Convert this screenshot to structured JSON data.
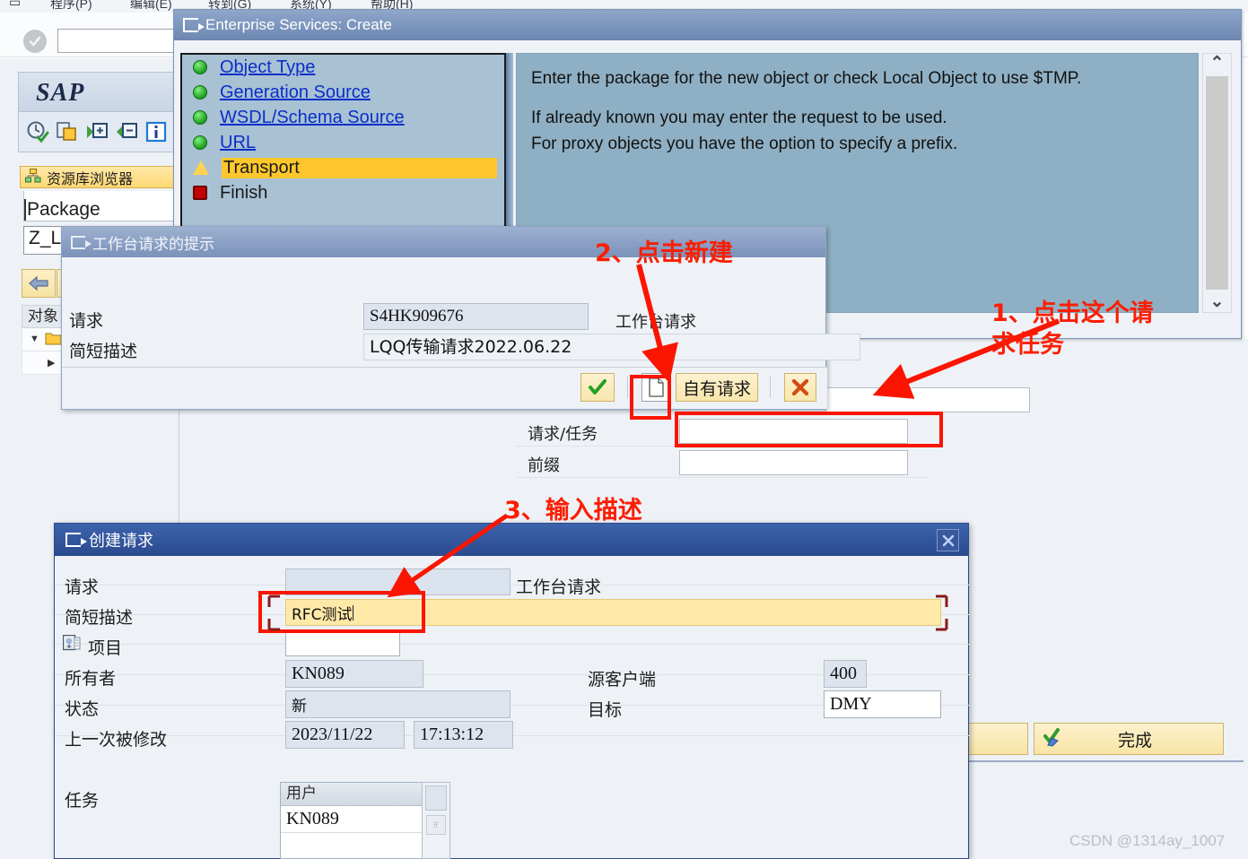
{
  "menubar": {
    "items": [
      "程序(P)",
      "编辑(E)",
      "转到(G)",
      "系统(Y)",
      "帮助(H)"
    ]
  },
  "command_field": {
    "value": "",
    "placeholder": ""
  },
  "sidebar": {
    "logo": "SAP",
    "repository_browser": "资源库浏览器",
    "package_label": "Package",
    "package_value": "Z_L",
    "object_column_header": "对象"
  },
  "es_window": {
    "title": "Enterprise Services: Create",
    "steps": [
      {
        "label": "Object Type",
        "state": "green",
        "link": true
      },
      {
        "label": "Generation Source",
        "state": "green",
        "link": true
      },
      {
        "label": "WSDL/Schema Source",
        "state": "green",
        "link": true
      },
      {
        "label": "URL",
        "state": "green",
        "link": true
      },
      {
        "label": "Transport",
        "state": "warn",
        "link": false,
        "active": true
      },
      {
        "label": "Finish",
        "state": "stop",
        "link": false
      }
    ],
    "help_lines": [
      "Enter the package for the new object or check Local Object to use $TMP.",
      "",
      "If already known you may enter the request to be used.",
      "For proxy objects you have the option to specify a prefix."
    ],
    "finish_button": "完成"
  },
  "request_form": {
    "rows": [
      {
        "label": "请求/任务",
        "value": ""
      },
      {
        "label": "前缀",
        "value": ""
      }
    ]
  },
  "dialog_prompt": {
    "title": "工作台请求的提示",
    "request_label": "请求",
    "request_value": "S4HK909676",
    "request_note": "工作台请求",
    "desc_label": "简短描述",
    "desc_value": "LQQ传输请求2022.06.22",
    "buttons": {
      "confirm": "✔",
      "new": "new-document",
      "own_request": "自有请求",
      "cancel": "✖"
    }
  },
  "dialog_create": {
    "title": "创建请求",
    "close": "✖",
    "fields": {
      "request_label": "请求",
      "request_value": "",
      "request_note": "工作台请求",
      "desc_label": "简短描述",
      "desc_value": "RFC测试",
      "project_label": "项目",
      "project_value": "",
      "owner_label": "所有者",
      "owner_value": "KN089",
      "status_label": "状态",
      "status_value": "新",
      "lastmod_label": "上一次被修改",
      "lastmod_date": "2023/11/22",
      "lastmod_time": "17:13:12",
      "source_client_label": "源客户端",
      "source_client_value": "400",
      "target_label": "目标",
      "target_value": "DMY",
      "task_label": "任务",
      "task_table_header": "用户",
      "task_rows": [
        "KN089"
      ]
    }
  },
  "annotations": [
    {
      "id": "a1",
      "text": "1、点击这个请\n求任务"
    },
    {
      "id": "a2",
      "text": "2、点击新建"
    },
    {
      "id": "a3",
      "text": "3、输入描述"
    }
  ],
  "watermark": "CSDN @1314ay_1007",
  "colors": {
    "annotation_red": "#fc1d00",
    "highlight_yellow": "#ffc72c",
    "dialog_blue": "#2a4a8e",
    "input_yellow": "#ffe9a8"
  }
}
